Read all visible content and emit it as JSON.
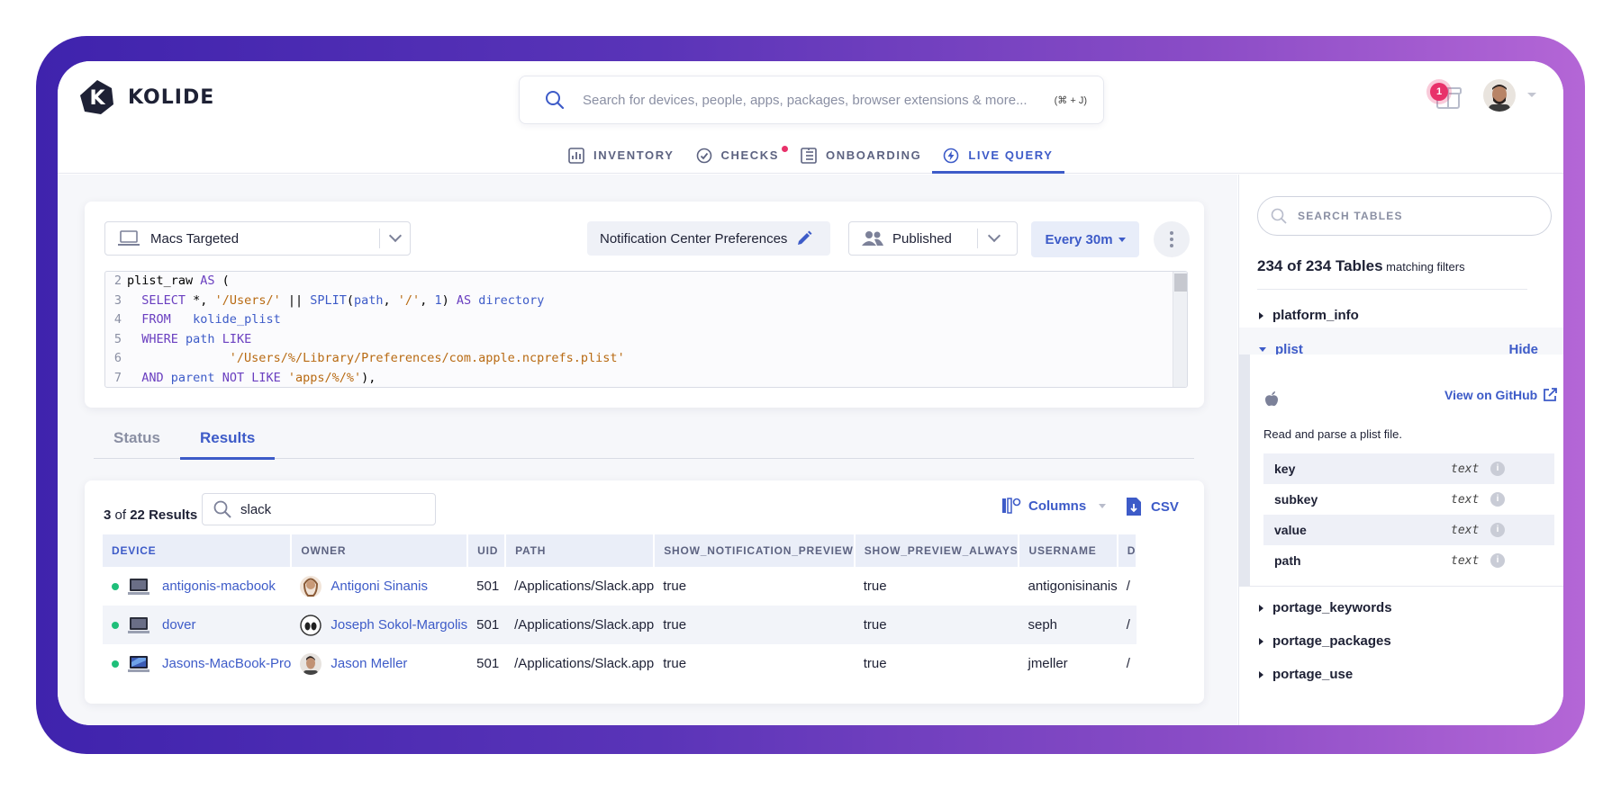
{
  "brand": {
    "name": "KOLIDE",
    "logo_letter": "K"
  },
  "search": {
    "placeholder": "Search for devices, people, apps, packages, browser extensions & more...",
    "shortcut": "(⌘ + J)"
  },
  "nav": [
    {
      "label": "INVENTORY",
      "icon": "bar-chart-icon"
    },
    {
      "label": "CHECKS",
      "icon": "check-circle-icon",
      "dot": true
    },
    {
      "label": "ONBOARDING",
      "icon": "checklist-icon"
    },
    {
      "label": "LIVE QUERY",
      "icon": "bolt-icon",
      "active": true
    }
  ],
  "notifications": {
    "count": "1"
  },
  "query": {
    "target": "Macs Targeted",
    "name": "Notification Center Preferences",
    "status": "Published",
    "interval": "Every 30m",
    "code_lines": [
      {
        "n": "2",
        "html": "plist_raw <span class='kw'>AS</span> ("
      },
      {
        "n": "3",
        "html": "  <span class='kw'>SELECT</span> *, <span class='str'>'/Users/'</span> || <span class='fn'>SPLIT</span>(<span class='fn'>path</span>, <span class='str'>'/'</span>, <span class='num'>1</span>) <span class='kw'>AS</span> <span class='fn'>directory</span>"
      },
      {
        "n": "4",
        "html": "  <span class='kw'>FROM</span>   <span class='fn'>kolide_plist</span>"
      },
      {
        "n": "5",
        "html": "  <span class='kw'>WHERE</span> <span class='fn'>path</span> <span class='kw'>LIKE</span>"
      },
      {
        "n": "6",
        "html": "              <span class='str'>'/Users/%/Library/Preferences/com.apple.ncprefs.plist'</span>"
      },
      {
        "n": "7",
        "html": "  <span class='kw'>AND</span> <span class='fn'>parent</span> <span class='kw'>NOT LIKE</span> <span class='str'>'apps/%/%'</span>),"
      }
    ]
  },
  "tabs": {
    "status": "Status",
    "results": "Results"
  },
  "results": {
    "shown": "3",
    "total": "22",
    "label": "Results",
    "of": "of",
    "filter": "slack",
    "columns_label": "Columns",
    "csv_label": "CSV",
    "headers": [
      "DEVICE",
      "OWNER",
      "UID",
      "PATH",
      "SHOW_NOTIFICATION_PREVIEW",
      "SHOW_PREVIEW_ALWAYS",
      "USERNAME",
      "D"
    ],
    "rows": [
      {
        "device": "antigonis-macbook",
        "owner": "Antigoni Sinanis",
        "uid": "501",
        "path": "/Applications/Slack.app",
        "snp": "true",
        "spa": "true",
        "username": "antigonisinanis",
        "d": "/ "
      },
      {
        "device": "dover",
        "owner": "Joseph Sokol-Margolis",
        "uid": "501",
        "path": "/Applications/Slack.app",
        "snp": "true",
        "spa": "true",
        "username": "seph",
        "d": "/ "
      },
      {
        "device": "Jasons-MacBook-Pro",
        "owner": "Jason Meller",
        "uid": "501",
        "path": "/Applications/Slack.app",
        "snp": "true",
        "spa": "true",
        "username": "jmeller",
        "d": "/ "
      }
    ]
  },
  "sidebar": {
    "search_placeholder": "SEARCH TABLES",
    "count_strong": "234 of 234 Tables",
    "count_rest": "matching filters",
    "tables_top": [
      "platform_info"
    ],
    "expanded": {
      "name": "plist",
      "hide_label": "Hide",
      "github_label": "View on GitHub",
      "description": "Read and parse a plist file.",
      "schema": [
        {
          "name": "key",
          "type": "text"
        },
        {
          "name": "subkey",
          "type": "text"
        },
        {
          "name": "value",
          "type": "text"
        },
        {
          "name": "path",
          "type": "text"
        }
      ]
    },
    "tables_bottom": [
      "portage_keywords",
      "portage_packages",
      "portage_use"
    ]
  },
  "colors": {
    "accent": "#3d5bc8",
    "alert": "#e8316a",
    "online": "#1fbf7a",
    "frame_start": "#3f23ad",
    "frame_end": "#b466d6"
  }
}
